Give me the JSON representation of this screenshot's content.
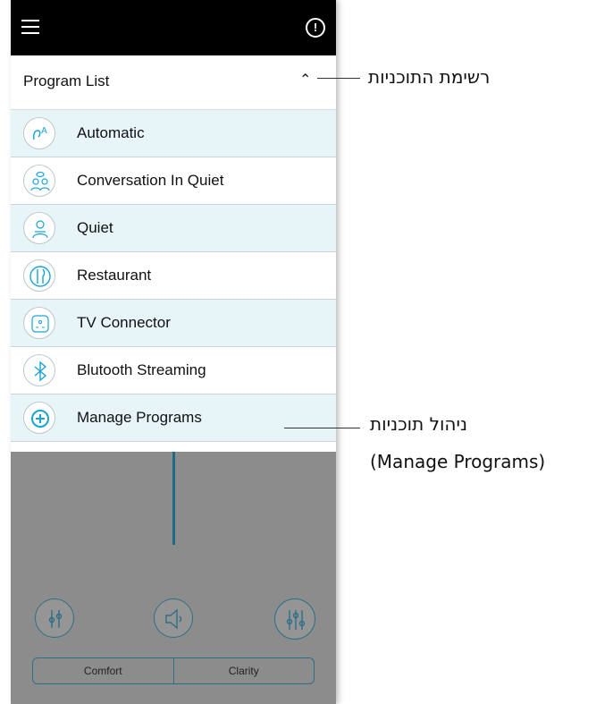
{
  "header": {
    "title": "Program List"
  },
  "programs": [
    {
      "label": "Automatic",
      "icon": "automatic-icon"
    },
    {
      "label": "Conversation In Quiet",
      "icon": "conversation-icon"
    },
    {
      "label": "Quiet",
      "icon": "quiet-icon"
    },
    {
      "label": "Restaurant",
      "icon": "restaurant-icon"
    },
    {
      "label": "TV Connector",
      "icon": "tv-connector-icon"
    },
    {
      "label": "Blutooth Streaming",
      "icon": "bluetooth-icon"
    },
    {
      "label": "Manage Programs",
      "icon": "plus-icon"
    }
  ],
  "controls": {
    "comfort": "Comfort",
    "clarity": "Clarity"
  },
  "annotations": {
    "program_list": "רשימת התוכניות",
    "manage_he": "ניהול תוכניות",
    "manage_en": "(Manage Programs)"
  },
  "colors": {
    "accent": "#1aa3d6",
    "row_alt": "#e8f5f8",
    "topbar": "#000000"
  }
}
